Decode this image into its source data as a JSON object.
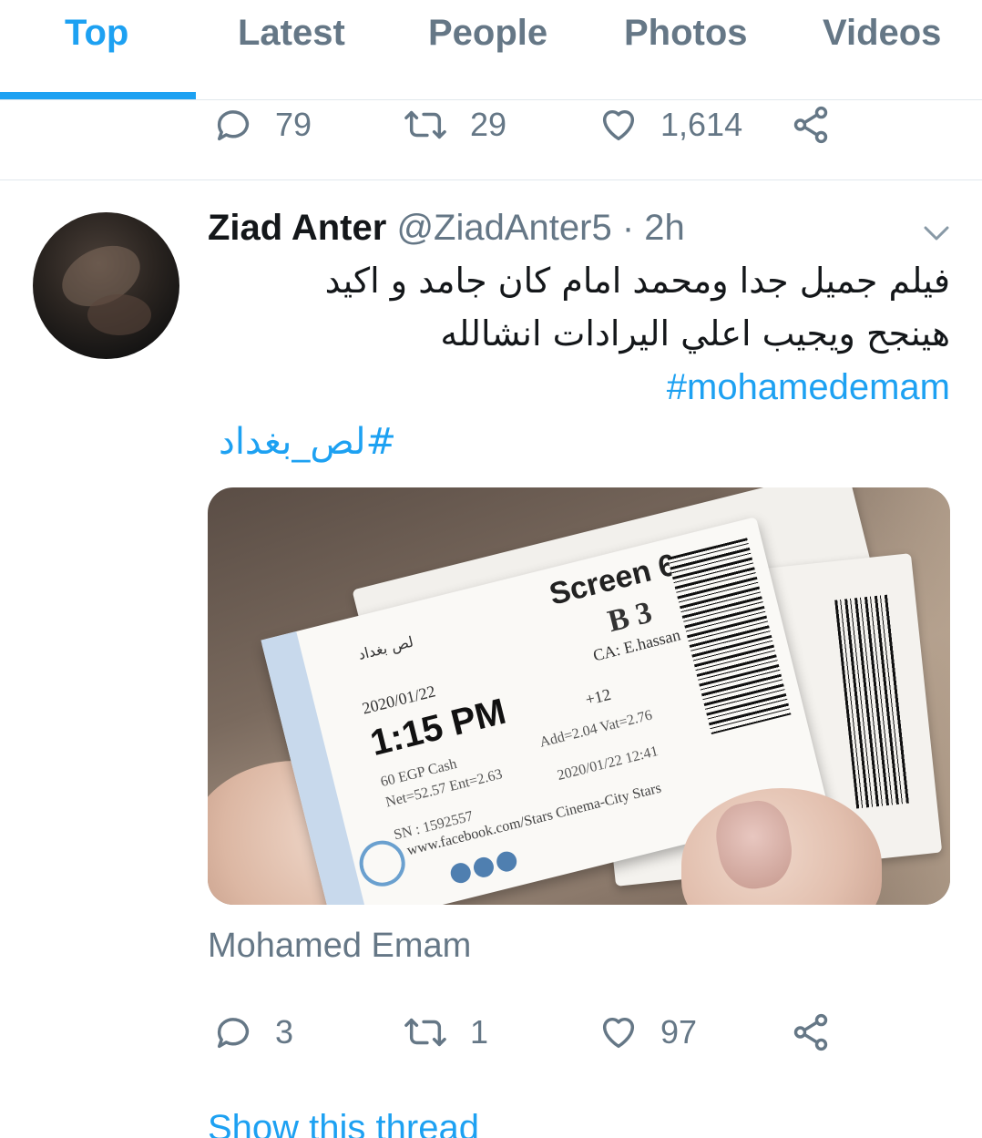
{
  "tabs": {
    "items": [
      {
        "label": "Top",
        "active": true
      },
      {
        "label": "Latest",
        "active": false
      },
      {
        "label": "People",
        "active": false
      },
      {
        "label": "Photos",
        "active": false
      },
      {
        "label": "Videos",
        "active": false
      }
    ]
  },
  "previous_tweet": {
    "actions": {
      "replies": "79",
      "retweets": "29",
      "likes": "1,614",
      "icons": [
        "reply-icon",
        "retweet-icon",
        "like-icon",
        "share-icon"
      ]
    }
  },
  "tweet": {
    "author_name": "Ziad Anter",
    "handle": "@ZiadAnter5",
    "separator": "·",
    "time": "2h",
    "text_line1": "فيلم جميل جدا ومحمد امام كان جامد و اكيد",
    "text_line2": "هينجح ويجيب اعلي اليرادات انشالله",
    "hashtag1": "#mohamedemam",
    "hashtag2": "#لص_بغداد",
    "media": {
      "ticket": {
        "title": "لص بغداد",
        "screen": "Screen 6",
        "seat": "B 3",
        "date": "2020/01/22",
        "ca": "CA: E.hassan",
        "time": "1:15 PM",
        "age": "+12",
        "price": "60 EGP Cash",
        "tax": "Add=2.04 Vat=2.76",
        "net": "Net=52.57 Ent=2.63",
        "stamp": "2020/01/22 12:41",
        "sn": "SN : 1592557",
        "web": "www.facebook.com/Stars Cinema-City Stars"
      }
    },
    "media_caption": "Mohamed Emam",
    "actions": {
      "replies": "3",
      "retweets": "1",
      "likes": "97"
    },
    "show_thread": "Show this thread"
  },
  "colors": {
    "accent": "#1da1f2",
    "secondary_text": "#657786",
    "divider": "#e1e8ed"
  }
}
